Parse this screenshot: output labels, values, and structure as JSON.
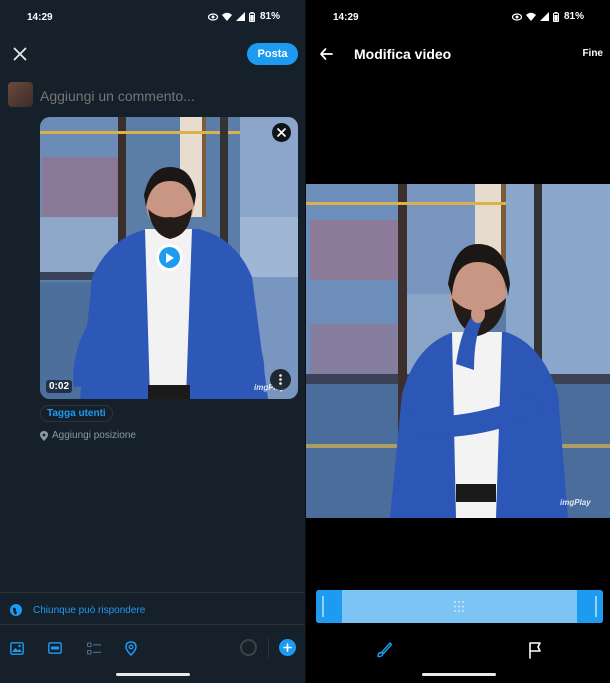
{
  "left_screen": {
    "status_bar": {
      "time": "14:29",
      "battery": "81%"
    },
    "header": {
      "close_icon": "close-icon",
      "post_label": "Posta"
    },
    "composer": {
      "placeholder": "Aggiungi un commento..."
    },
    "media": {
      "duration": "0:02",
      "watermark": "imgPlay",
      "play_icon": "play-icon",
      "remove_icon": "close-icon",
      "more_icon": "more-vertical-icon"
    },
    "tag_users_label": "Tagga utenti",
    "add_location_label": "Aggiungi posizione",
    "reply_setting_label": "Chiunque può rispondere",
    "toolbar": {
      "icons": [
        "image-icon",
        "gif-icon",
        "poll-icon",
        "location-pin-icon"
      ],
      "add_icon": "plus-icon"
    },
    "colors": {
      "background": "#15202b",
      "accent": "#1d9bf0",
      "muted": "#71767b"
    }
  },
  "right_screen": {
    "status_bar": {
      "time": "14:29",
      "battery": "81%"
    },
    "header": {
      "back_icon": "arrow-left-icon",
      "title": "Modifica video",
      "done_label": "Fine"
    },
    "video": {
      "watermark": "imgPlay"
    },
    "trim": {
      "start_fraction": 0.0,
      "end_fraction": 1.0
    },
    "tools": [
      "brush-icon",
      "flag-icon"
    ],
    "colors": {
      "background": "#000000",
      "trim_fill": "#7cc4f4",
      "trim_handle": "#1d9bf0"
    }
  }
}
